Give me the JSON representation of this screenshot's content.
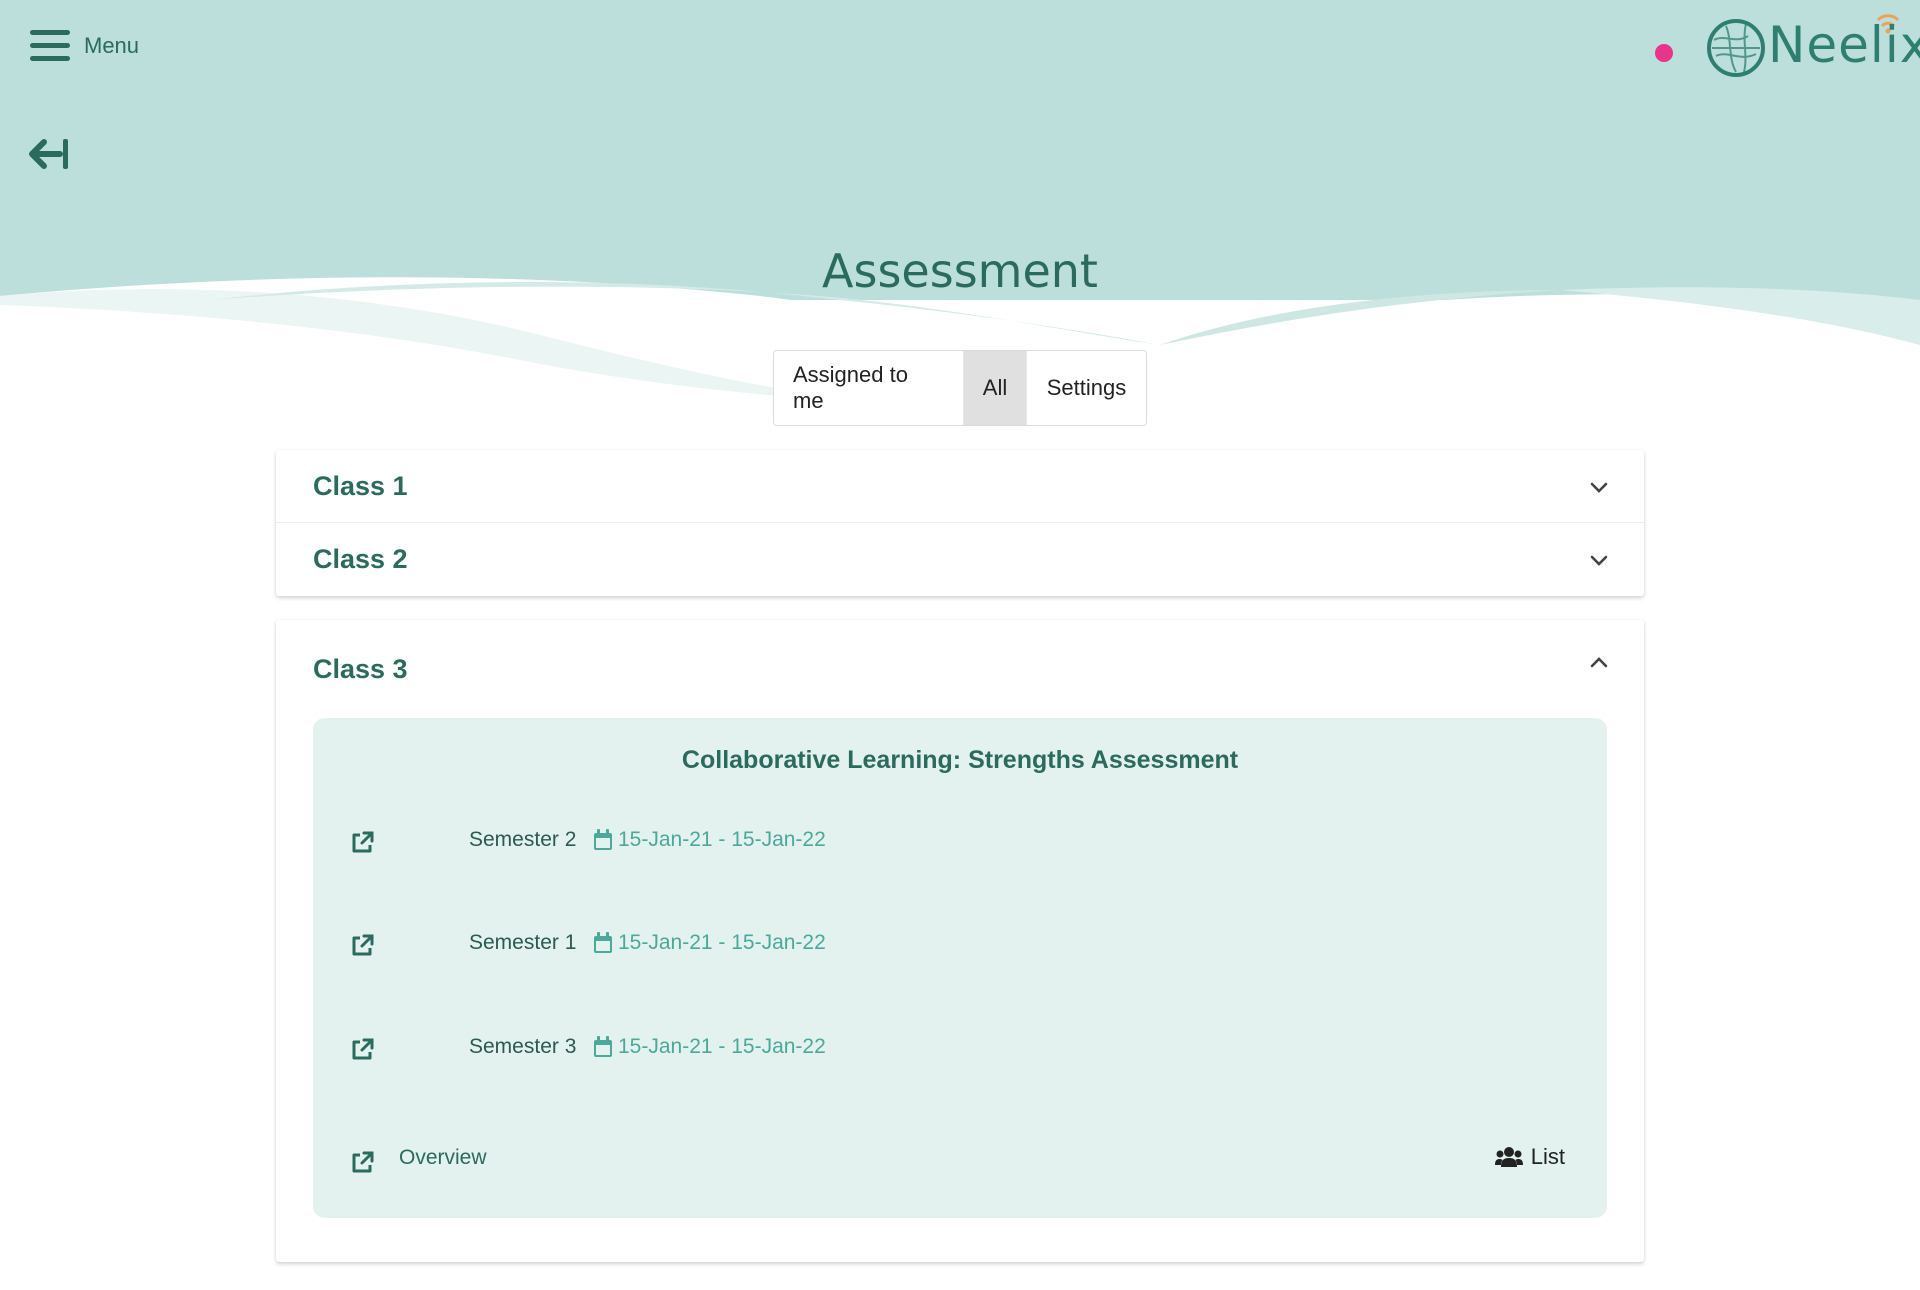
{
  "header": {
    "menu_label": "Menu",
    "logo_text": "Neelix",
    "page_title": "Assessment"
  },
  "colors": {
    "primary": "#2a6b5d",
    "hero_bg": "#bcdfdb",
    "panel_bg": "#e3f1ef",
    "date_text": "#4aa99a",
    "status_dot": "#e8358a",
    "active_tab": "#e0e0e0"
  },
  "tabs": [
    {
      "label": "Assigned to me",
      "active": false
    },
    {
      "label": "All",
      "active": true
    },
    {
      "label": "Settings",
      "active": false
    }
  ],
  "classes": [
    {
      "title": "Class 1",
      "expanded": false
    },
    {
      "title": "Class 2",
      "expanded": false
    },
    {
      "title": "Class 3",
      "expanded": true
    }
  ],
  "assessment": {
    "title": "Collaborative Learning: Strengths Assessment",
    "sessions": [
      {
        "name": "Semester 2",
        "dates": "15-Jan-21 - 15-Jan-22"
      },
      {
        "name": "Semester 1",
        "dates": "15-Jan-21 - 15-Jan-22"
      },
      {
        "name": "Semester 3",
        "dates": "15-Jan-21 - 15-Jan-22"
      }
    ],
    "overview_label": "Overview",
    "list_label": "List"
  },
  "icons": {
    "menu": "hamburger-icon",
    "back": "arrow-to-left-icon",
    "expand": "chevron-down-icon",
    "collapse": "chevron-up-icon",
    "open": "external-link-icon",
    "date": "calendar-icon",
    "list": "users-icon"
  }
}
